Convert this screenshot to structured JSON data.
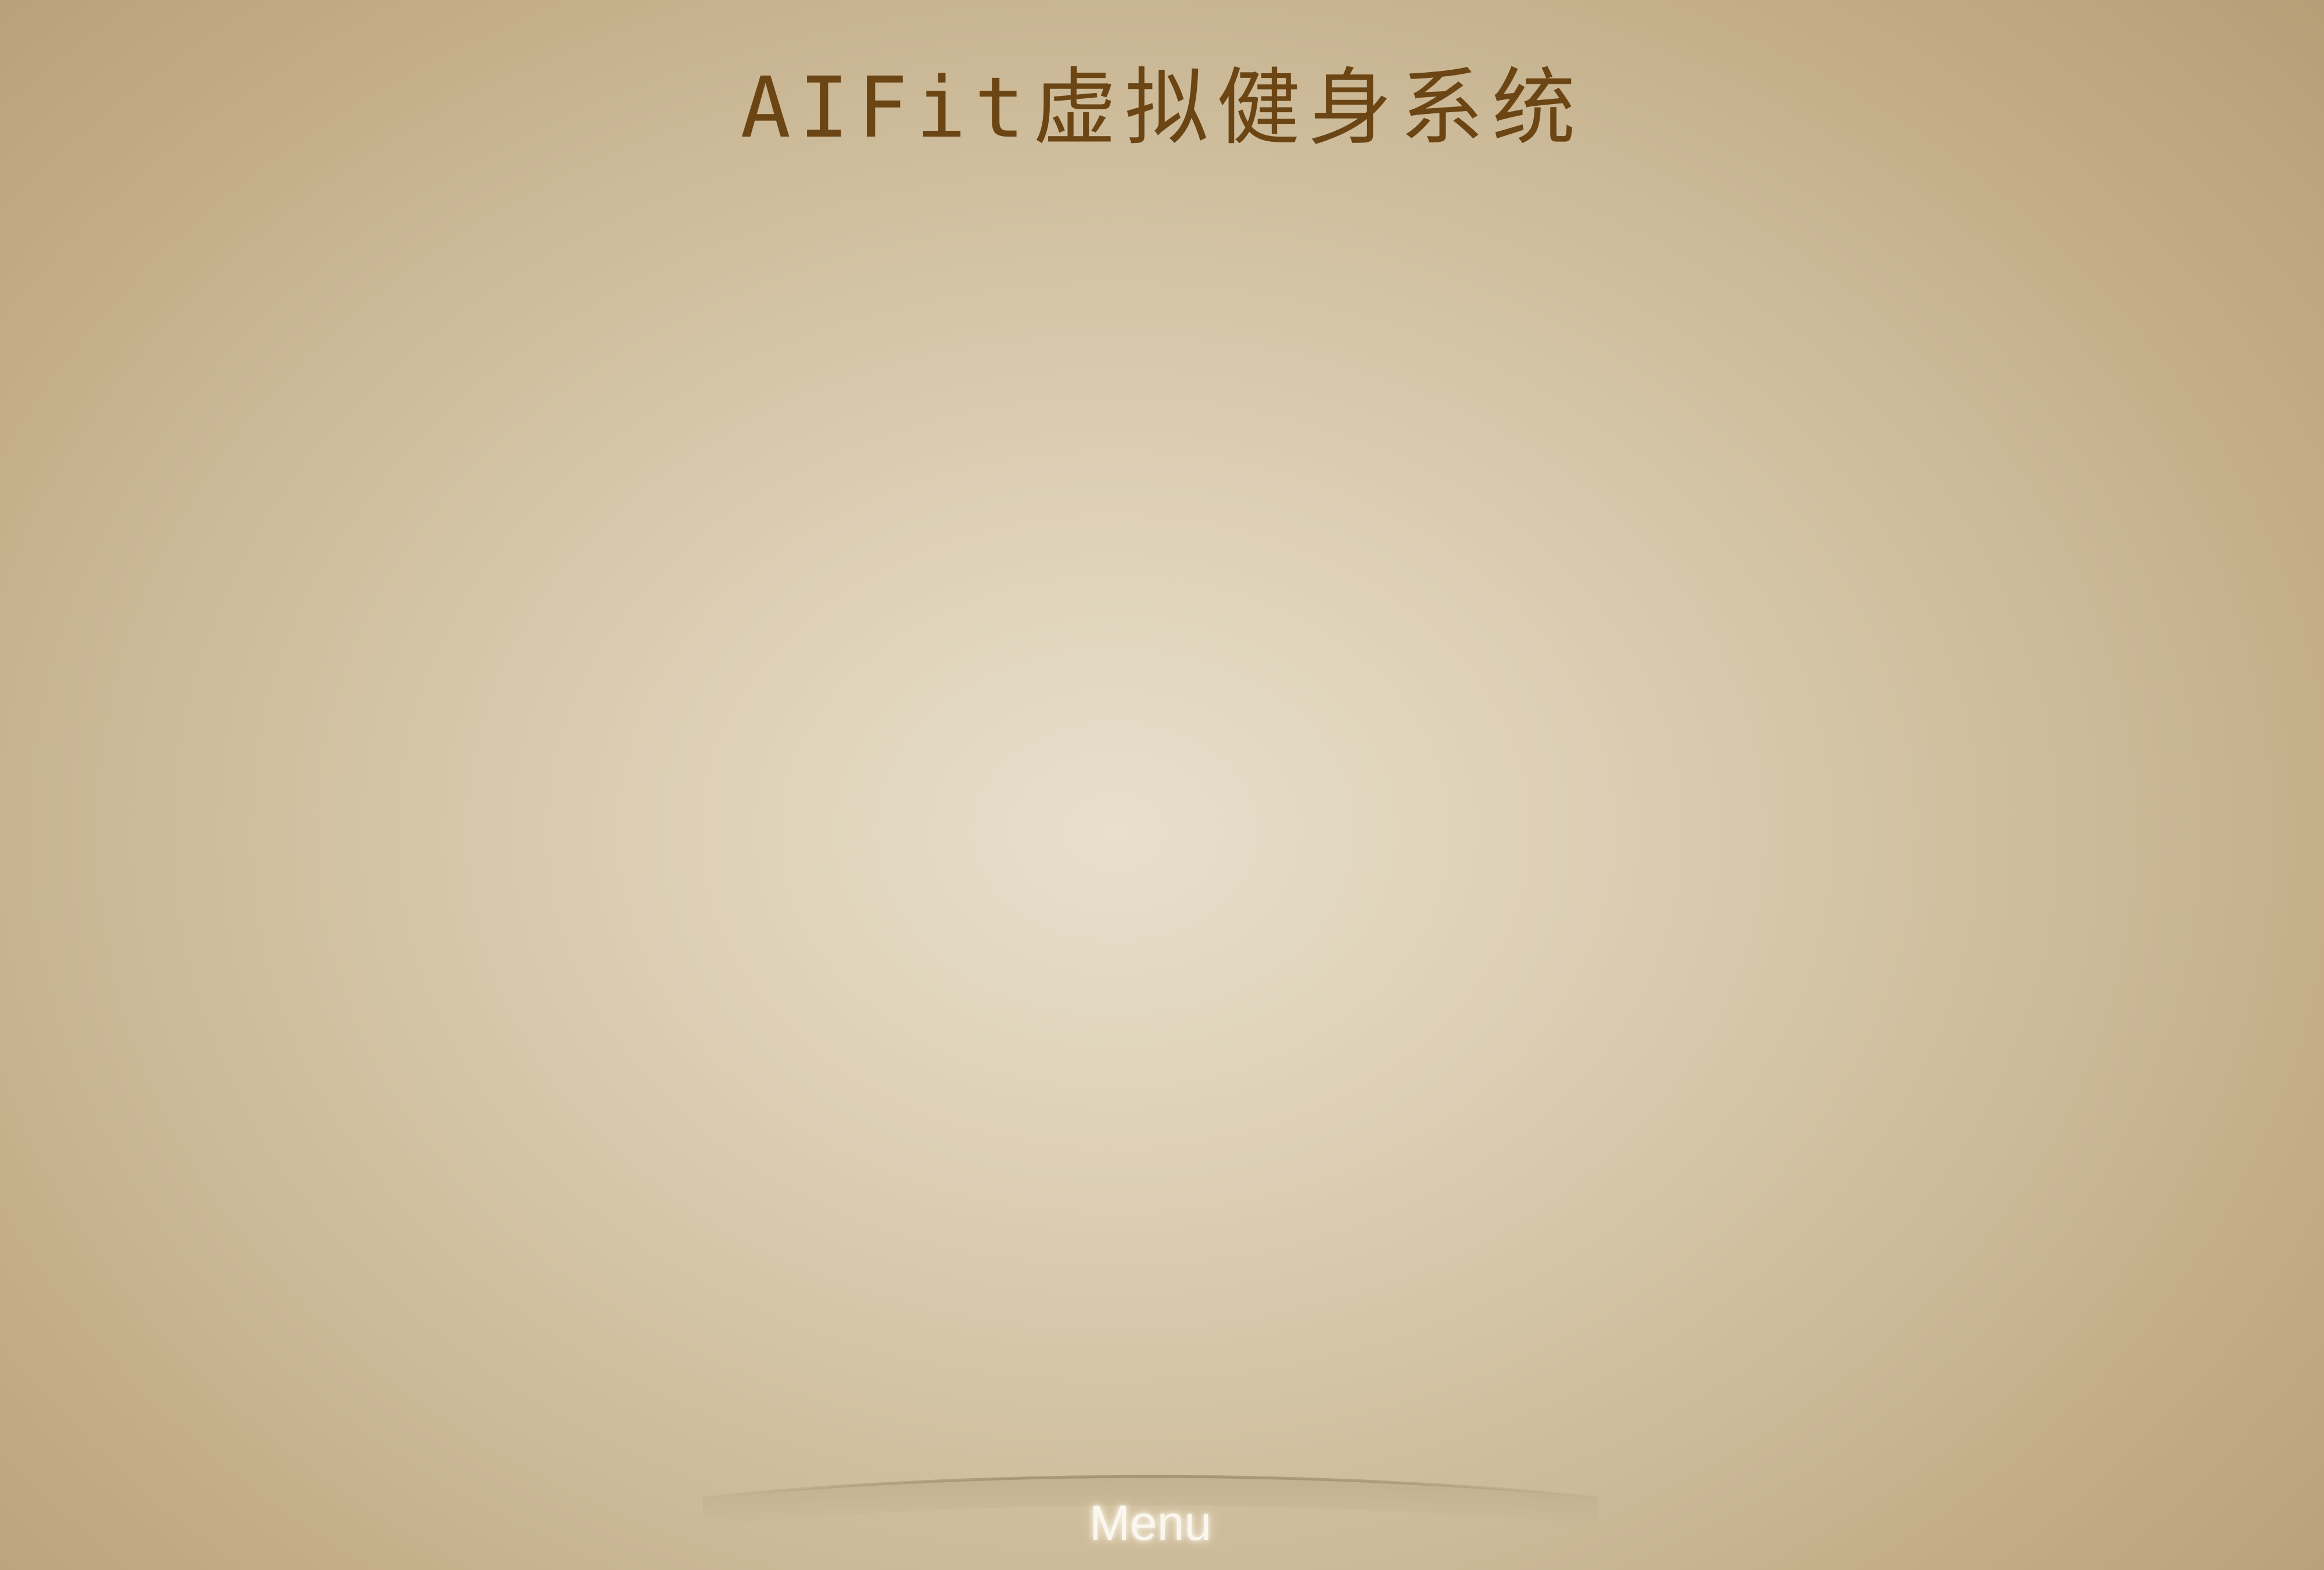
{
  "app": {
    "title": "AIFit虚拟健身系统"
  },
  "menu": {
    "label": "Menu"
  },
  "colors": {
    "title_text": "#6b4514",
    "background_center": "#e8dfcc",
    "background_edge": "#b29a72",
    "menu_text": "#fbf7ee"
  }
}
